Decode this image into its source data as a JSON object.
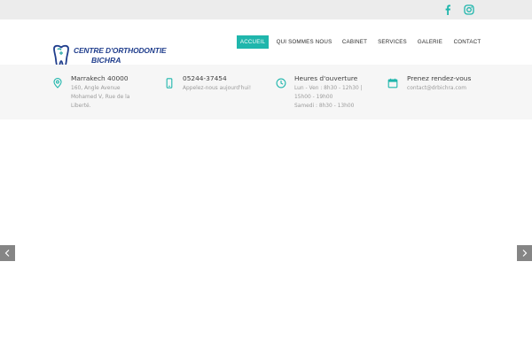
{
  "social": {
    "facebook_icon": "facebook-icon",
    "instagram_icon": "instagram-icon",
    "color": "#1fb6ac"
  },
  "logo": {
    "line1": "CENTRE D'ORTHODONTIE",
    "line2": "BICHRA",
    "icon": "tooth-icon",
    "color": "#1f3d8c"
  },
  "nav": {
    "items": [
      {
        "label": "ACCUEIL",
        "active": true
      },
      {
        "label": "QUI SOMMES NOUS",
        "active": false
      },
      {
        "label": "CABINET",
        "active": false
      },
      {
        "label": "SERVICES",
        "active": false
      },
      {
        "label": "GALERIE",
        "active": false
      },
      {
        "label": "CONTACT",
        "active": false
      }
    ],
    "active_color": "#1fb6ac"
  },
  "info": [
    {
      "icon": "map-pin-icon",
      "title": "Marrakech 40000",
      "lines": [
        "160, Angle Avenue",
        "Mohamed V, Rue de la",
        "Liberté."
      ]
    },
    {
      "icon": "mobile-phone-icon",
      "title": "05244-37454",
      "lines": [
        "Appelez-nous aujourd'hui!"
      ]
    },
    {
      "icon": "clock-icon",
      "title": "Heures d'ouverture",
      "lines": [
        "Lun - Ven : 8h30 - 12h30 |",
        "15h00 - 19h00",
        "Samedi : 8h30 - 13h00"
      ]
    },
    {
      "icon": "calendar-icon",
      "title": "Prenez rendez-vous",
      "lines": [
        "contact@drbichra.com"
      ]
    }
  ],
  "slider": {
    "prev_icon": "chevron-left-icon",
    "next_icon": "chevron-right-icon"
  }
}
